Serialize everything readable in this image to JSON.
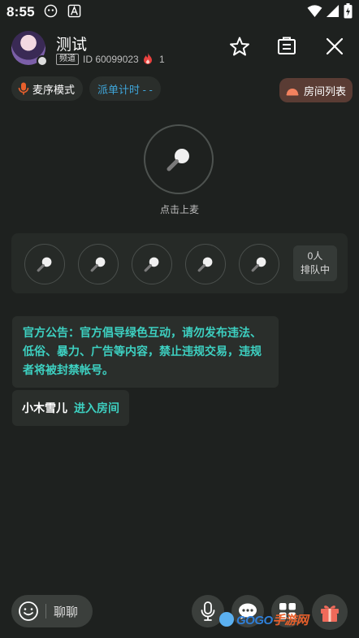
{
  "status_bar": {
    "time": "8:55"
  },
  "header": {
    "title": "测试",
    "channel_badge": "频道",
    "room_id": "ID 60099023",
    "heat": "1"
  },
  "chips": {
    "mode": "麦序模式",
    "timer": "派单计时 - -",
    "room_list": "房间列表"
  },
  "host_seat": {
    "label": "点击上麦"
  },
  "seats": {
    "count": 5
  },
  "queue": {
    "count": "0人",
    "label": "排队中"
  },
  "announcement": "官方公告：官方倡导绿色互动，请勿发布违法、低俗、暴力、广告等内容，禁止违规交易，违规者将被封禁帐号。",
  "entry_message": {
    "user": "小木雪儿",
    "action": "进入房间"
  },
  "bottom_bar": {
    "chat_placeholder": "聊聊"
  },
  "watermark": {
    "latin": "GOGO",
    "cn": "手游网"
  },
  "colors": {
    "accent": "#3dd0c1",
    "timer": "#3fa5d9",
    "room_list_bg": "#5a3c34",
    "background": "#1e211f"
  }
}
